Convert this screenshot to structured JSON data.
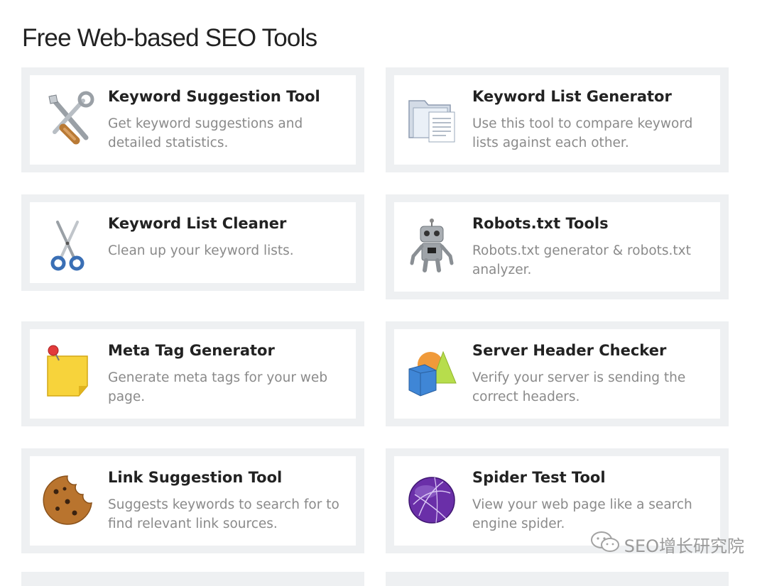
{
  "page": {
    "title": "Free Web-based SEO Tools"
  },
  "tools": [
    {
      "name": "Keyword Suggestion Tool",
      "description": "Get keyword suggestions and detailed statistics.",
      "icon": "wrench-screwdriver-icon"
    },
    {
      "name": "Keyword List Generator",
      "description": "Use this tool to compare keyword lists against each other.",
      "icon": "folder-documents-icon"
    },
    {
      "name": "Keyword List Cleaner",
      "description": "Clean up your keyword lists.",
      "icon": "scissors-icon"
    },
    {
      "name": "Robots.txt Tools",
      "description": "Robots.txt generator & robots.txt analyzer.",
      "icon": "robot-icon"
    },
    {
      "name": "Meta Tag Generator",
      "description": "Generate meta tags for your web page.",
      "icon": "sticky-note-pin-icon"
    },
    {
      "name": "Server Header Checker",
      "description": "Verify your server is sending the correct headers.",
      "icon": "geometric-shapes-icon"
    },
    {
      "name": "Link Suggestion Tool",
      "description": "Suggests keywords to search for to find relevant link sources.",
      "icon": "cookie-icon"
    },
    {
      "name": "Spider Test Tool",
      "description": "View your web page like a search engine spider.",
      "icon": "purple-globe-icon"
    }
  ],
  "watermark": {
    "text": "SEO增长研究院",
    "icon": "wechat-icon"
  },
  "colors": {
    "card_border": "#eef0f2",
    "title_text": "#222222",
    "description_text": "#8a8a8a"
  }
}
